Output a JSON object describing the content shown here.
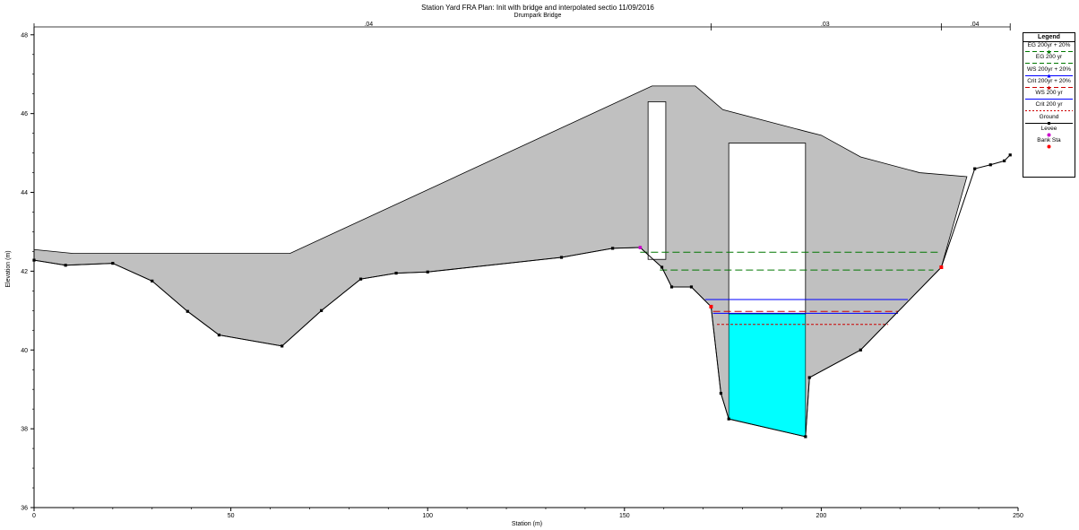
{
  "chart_data": {
    "type": "area",
    "title": "Station Yard FRA       Plan: Init with bridge and interpolated sectio     11/09/2016",
    "subtitle": "Drumpark Bridge",
    "xlabel": "Station (m)",
    "ylabel": "Elevation (m)",
    "xlim": [
      0,
      250
    ],
    "ylim": [
      36,
      48.2
    ],
    "xticks": [
      0,
      50,
      100,
      150,
      200,
      250
    ],
    "yticks": [
      36,
      38,
      40,
      42,
      44,
      46,
      48
    ],
    "grid": false,
    "legend_position": "right",
    "manning_n": [
      {
        "label": ".04",
        "x": 85
      },
      {
        "label": ".03",
        "x": 201
      },
      {
        "label": ".04",
        "x": 239
      }
    ],
    "manning_breaks": [
      0,
      172,
      230.5,
      248
    ],
    "deck_top": [
      [
        0,
        42.55
      ],
      [
        10,
        42.45
      ],
      [
        65,
        42.45
      ],
      [
        157,
        46.7
      ],
      [
        168,
        46.7
      ],
      [
        175,
        46.1
      ],
      [
        196,
        45.55
      ],
      [
        200,
        45.45
      ],
      [
        210,
        44.9
      ],
      [
        225,
        44.5
      ],
      [
        237,
        44.4
      ]
    ],
    "ground": [
      [
        0,
        42.28
      ],
      [
        8,
        42.15
      ],
      [
        20,
        42.2
      ],
      [
        30,
        41.75
      ],
      [
        39,
        40.98
      ],
      [
        47,
        40.38
      ],
      [
        63,
        40.1
      ],
      [
        73,
        41.0
      ],
      [
        83,
        41.8
      ],
      [
        92,
        41.95
      ],
      [
        100,
        41.98
      ],
      [
        134,
        42.35
      ],
      [
        147,
        42.58
      ],
      [
        154,
        42.6
      ],
      [
        159.5,
        42.1
      ],
      [
        162,
        41.6
      ],
      [
        167,
        41.6
      ],
      [
        172,
        41.1
      ],
      [
        174.5,
        38.9
      ],
      [
        176.5,
        38.25
      ],
      [
        196,
        37.8
      ],
      [
        197,
        39.3
      ],
      [
        210,
        40.0
      ],
      [
        230.5,
        42.1
      ],
      [
        239,
        44.6
      ],
      [
        243,
        44.7
      ],
      [
        246.5,
        44.8
      ],
      [
        248,
        44.95
      ]
    ],
    "pier_left": {
      "x1": 156,
      "x2": 160.5,
      "top": 46.3
    },
    "pier_right": {
      "x1": 176.5,
      "x2": 196,
      "top": 45.25
    },
    "series": [
      {
        "name": "EG 200yr + 20%",
        "style": "dashed",
        "color": "#007700",
        "x": [
          154,
          230.5
        ],
        "y": 42.48
      },
      {
        "name": "EG 200 yr",
        "style": "dashed",
        "color": "#007700",
        "x": [
          159,
          228.5
        ],
        "y": 42.03
      },
      {
        "name": "WS 200yr + 20%",
        "style": "solid",
        "color": "#0000ff",
        "x": [
          170.5,
          222
        ],
        "y": 41.28
      },
      {
        "name": "Crit 200yr + 20%",
        "style": "dashed",
        "color": "#cc0000",
        "x": [
          172.5,
          219.5
        ],
        "y": 40.98
      },
      {
        "name": "WS 200 yr",
        "style": "solid",
        "color": "#0000ff",
        "x": [
          172.5,
          219.5
        ],
        "y": 40.93
      },
      {
        "name": "Crit 200 yr",
        "style": "dotted",
        "color": "#cc0000",
        "x": [
          173.5,
          217
        ],
        "y": 40.65
      }
    ],
    "water_fill": {
      "x_left": 176.5,
      "x_right": 196,
      "surface": 40.92,
      "color": "#00ffff"
    },
    "levee": [
      [
        154,
        42.6
      ]
    ],
    "bank_stations": [
      [
        172,
        41.1
      ],
      [
        230.5,
        42.1
      ]
    ],
    "legend": {
      "title": "Legend",
      "items": [
        {
          "label": "EG 200yr + 20%",
          "color": "#007700",
          "style": "dashed",
          "marker": "triangle"
        },
        {
          "label": "EG 200 yr",
          "color": "#007700",
          "style": "dashed",
          "marker": "none"
        },
        {
          "label": "WS 200yr + 20%",
          "color": "#0000ff",
          "style": "solid",
          "marker": "triangle"
        },
        {
          "label": "Crit 200yr + 20%",
          "color": "#cc0000",
          "style": "dashed",
          "marker": "triangle"
        },
        {
          "label": "WS 200 yr",
          "color": "#0000ff",
          "style": "solid",
          "marker": "none"
        },
        {
          "label": "Crit 200 yr",
          "color": "#cc0000",
          "style": "dotted",
          "marker": "none"
        },
        {
          "label": "Ground",
          "color": "#000000",
          "style": "solid",
          "marker": "square"
        },
        {
          "label": "Levee",
          "color": "#cc00cc",
          "style": "none",
          "marker": "circle"
        },
        {
          "label": "Bank Sta",
          "color": "#ff0000",
          "style": "none",
          "marker": "circle"
        }
      ]
    },
    "colors": {
      "deck_fill": "#c0c0c0",
      "outline": "#000000"
    }
  }
}
